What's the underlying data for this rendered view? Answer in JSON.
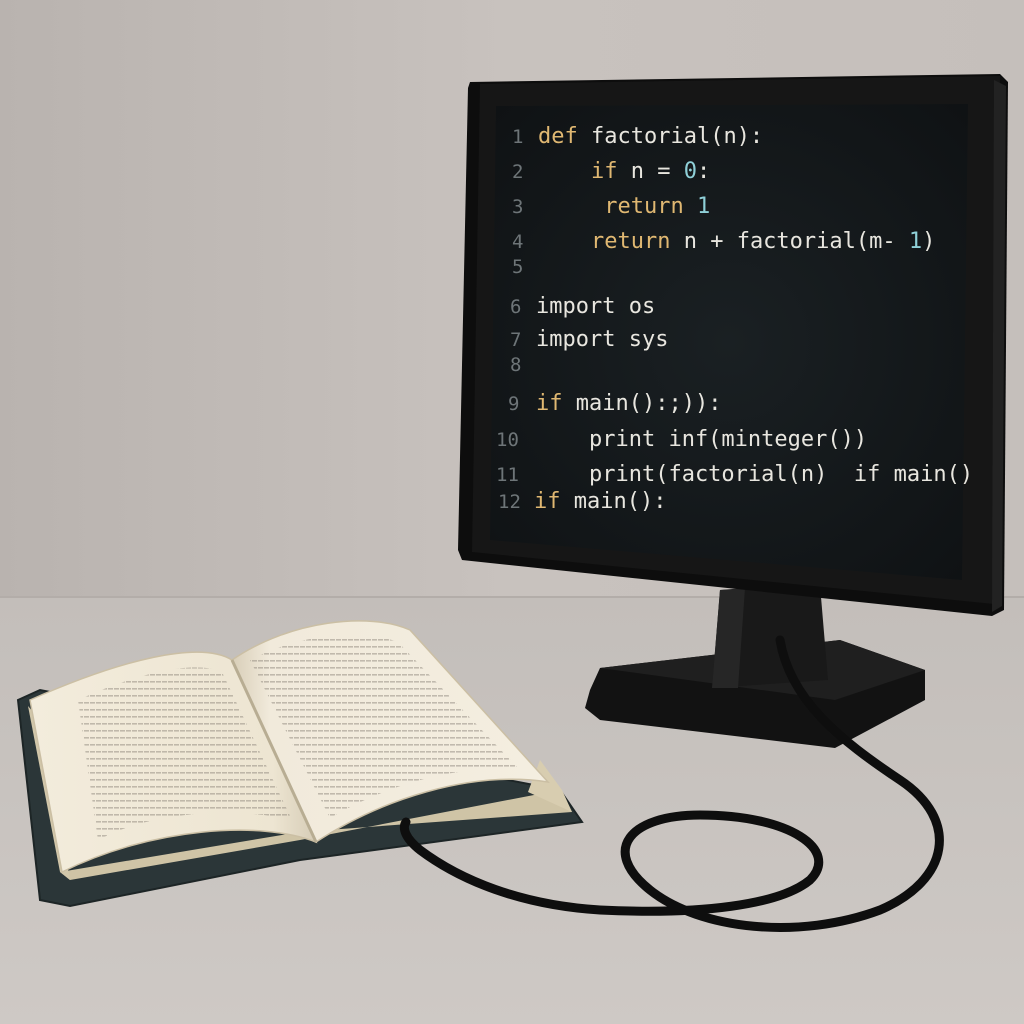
{
  "scene": {
    "colors": {
      "wall": "#c4bebb",
      "desk": "#c9c4c0",
      "monitor_body": "#141414",
      "screen_bg": "#111517",
      "keyword": "#e0b872",
      "number": "#8fd0d8",
      "code_text": "#e8e6df",
      "line_number": "#6e7578",
      "book_cover": "#2e3a3c",
      "page": "#efe8d8",
      "page_edge": "#d9cfb5",
      "cable": "#0e0e0e"
    }
  },
  "monitor": {
    "screen": {
      "code_lines": [
        {
          "num": "1",
          "segments": [
            {
              "text": "def",
              "kind": "keyword"
            },
            {
              "text": " factorial(n):",
              "kind": "plain"
            }
          ]
        },
        {
          "num": "2",
          "segments": [
            {
              "text": "    ",
              "kind": "plain"
            },
            {
              "text": "if",
              "kind": "keyword"
            },
            {
              "text": " n = ",
              "kind": "plain"
            },
            {
              "text": "0",
              "kind": "number"
            },
            {
              "text": ":",
              "kind": "plain"
            }
          ]
        },
        {
          "num": "3",
          "segments": [
            {
              "text": "     ",
              "kind": "plain"
            },
            {
              "text": "return",
              "kind": "keyword"
            },
            {
              "text": " ",
              "kind": "plain"
            },
            {
              "text": "1",
              "kind": "number"
            }
          ]
        },
        {
          "num": "4",
          "segments": [
            {
              "text": "    ",
              "kind": "plain"
            },
            {
              "text": "return",
              "kind": "keyword"
            },
            {
              "text": " n + factorial(m- ",
              "kind": "plain"
            },
            {
              "text": "1",
              "kind": "number"
            },
            {
              "text": ")",
              "kind": "plain"
            }
          ]
        },
        {
          "num": "5",
          "segments": []
        },
        {
          "num": "6",
          "segments": [
            {
              "text": "import os",
              "kind": "plain"
            }
          ]
        },
        {
          "num": "7",
          "segments": [
            {
              "text": "import sys",
              "kind": "plain"
            }
          ]
        },
        {
          "num": "8",
          "segments": []
        },
        {
          "num": "9",
          "segments": [
            {
              "text": "if",
              "kind": "keyword"
            },
            {
              "text": " main():;)):",
              "kind": "plain"
            }
          ]
        },
        {
          "num": "10",
          "segments": [
            {
              "text": "    print inf(minteger())",
              "kind": "plain"
            }
          ]
        },
        {
          "num": "11",
          "segments": [
            {
              "text": "    print(factorial(n)  if main()",
              "kind": "plain"
            }
          ]
        },
        {
          "num": "12",
          "segments": [
            {
              "text": "if",
              "kind": "keyword"
            },
            {
              "text": " main():",
              "kind": "plain"
            }
          ]
        }
      ]
    }
  }
}
